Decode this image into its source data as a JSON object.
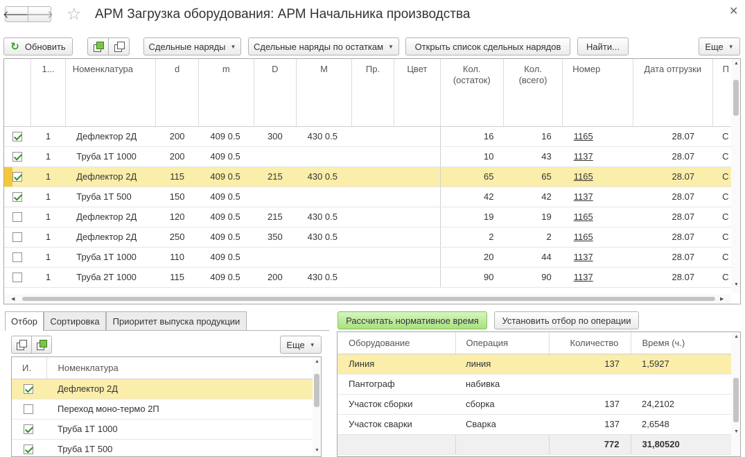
{
  "window": {
    "title": "АРМ Загрузка оборудования: АРМ Начальника производства",
    "back_glyph": "🡐",
    "forward_glyph": "🡒",
    "star_glyph": "☆",
    "close_glyph": "✕"
  },
  "toolbar": {
    "refresh_label": "Обновить",
    "piece_orders_label": "Сдельные наряды",
    "piece_orders_remain_label": "Сдельные наряды по остаткам",
    "open_list_label": "Открыть список сдельных нарядов",
    "find_label": "Найти...",
    "more_label": "Еще"
  },
  "main_grid": {
    "columns": [
      "1...",
      "Номенклатура",
      "d",
      "m",
      "D",
      "M",
      "Пр.",
      "Цвет",
      "Кол.\n(остаток)",
      "Кол.\n(всего)",
      "Номер",
      "Дата отгрузки",
      "П"
    ],
    "rows": [
      {
        "checked": true,
        "n": "1",
        "name": "Дефлектор 2Д",
        "d": "200",
        "m": "409 0.5",
        "D": "300",
        "M": "430 0.5",
        "pr": "",
        "color": "",
        "qty_rem": "16",
        "qty_all": "16",
        "number": "1165",
        "date": "28.07",
        "p": "С"
      },
      {
        "checked": true,
        "n": "1",
        "name": "Труба 1Т 1000",
        "d": "200",
        "m": "409 0.5",
        "D": "",
        "M": "",
        "pr": "",
        "color": "",
        "qty_rem": "10",
        "qty_all": "43",
        "number": "1137",
        "date": "28.07",
        "p": "С"
      },
      {
        "checked": true,
        "n": "1",
        "name": "Дефлектор 2Д",
        "d": "115",
        "m": "409 0.5",
        "D": "215",
        "M": "430 0.5",
        "pr": "",
        "color": "",
        "qty_rem": "65",
        "qty_all": "65",
        "number": "1165",
        "date": "28.07",
        "p": "С"
      },
      {
        "checked": true,
        "n": "1",
        "name": "Труба 1Т 500",
        "d": "150",
        "m": "409 0.5",
        "D": "",
        "M": "",
        "pr": "",
        "color": "",
        "qty_rem": "42",
        "qty_all": "42",
        "number": "1137",
        "date": "28.07",
        "p": "С"
      },
      {
        "checked": false,
        "n": "1",
        "name": "Дефлектор 2Д",
        "d": "120",
        "m": "409 0.5",
        "D": "215",
        "M": "430 0.5",
        "pr": "",
        "color": "",
        "qty_rem": "19",
        "qty_all": "19",
        "number": "1165",
        "date": "28.07",
        "p": "С"
      },
      {
        "checked": false,
        "n": "1",
        "name": "Дефлектор 2Д",
        "d": "250",
        "m": "409 0.5",
        "D": "350",
        "M": "430 0.5",
        "pr": "",
        "color": "",
        "qty_rem": "2",
        "qty_all": "2",
        "number": "1165",
        "date": "28.07",
        "p": "С"
      },
      {
        "checked": false,
        "n": "1",
        "name": "Труба 1Т 1000",
        "d": "110",
        "m": "409 0.5",
        "D": "",
        "M": "",
        "pr": "",
        "color": "",
        "qty_rem": "20",
        "qty_all": "44",
        "number": "1137",
        "date": "28.07",
        "p": "С"
      },
      {
        "checked": false,
        "n": "1",
        "name": "Труба 2Т 1000",
        "d": "115",
        "m": "409 0.5",
        "D": "200",
        "M": "430 0.5",
        "pr": "",
        "color": "",
        "qty_rem": "90",
        "qty_all": "90",
        "number": "1137",
        "date": "28.07",
        "p": "С"
      }
    ],
    "selected_row": 2
  },
  "left_panel": {
    "tabs": [
      "Отбор",
      "Сортировка",
      "Приоритет выпуска продукции"
    ],
    "active_tab": 0,
    "more_label": "Еще",
    "columns": [
      "И.",
      "Номенклатура"
    ],
    "rows": [
      {
        "checked": true,
        "name": "Дефлектор 2Д"
      },
      {
        "checked": false,
        "name": "Переход моно-термо 2П"
      },
      {
        "checked": true,
        "name": "Труба 1Т 1000"
      },
      {
        "checked": true,
        "name": "Труба 1Т 500"
      }
    ],
    "selected_row": 0
  },
  "right_panel": {
    "calc_button_label": "Рассчитать нормативное время",
    "filter_op_button_label": "Установить отбор по операции",
    "columns": [
      "Оборудование",
      "Операция",
      "Количество",
      "Время (ч.)"
    ],
    "rows": [
      {
        "equipment": "Линия",
        "operation": "линия",
        "qty": "137",
        "time": "1,5927"
      },
      {
        "equipment": "Пантограф",
        "operation": "набивка",
        "qty": "",
        "time": ""
      },
      {
        "equipment": "Участок сборки",
        "operation": "сборка",
        "qty": "137",
        "time": "24,2102"
      },
      {
        "equipment": "Участок сварки",
        "operation": "Сварка",
        "qty": "137",
        "time": "2,6548"
      }
    ],
    "totals": {
      "qty": "772",
      "time": "31,80520"
    },
    "selected_row": 0
  },
  "colors": {
    "selection": "#fbeeaa",
    "selection_marker": "#f3c93a",
    "green_button": "#a9e07f",
    "check": "#2f8f1f"
  }
}
